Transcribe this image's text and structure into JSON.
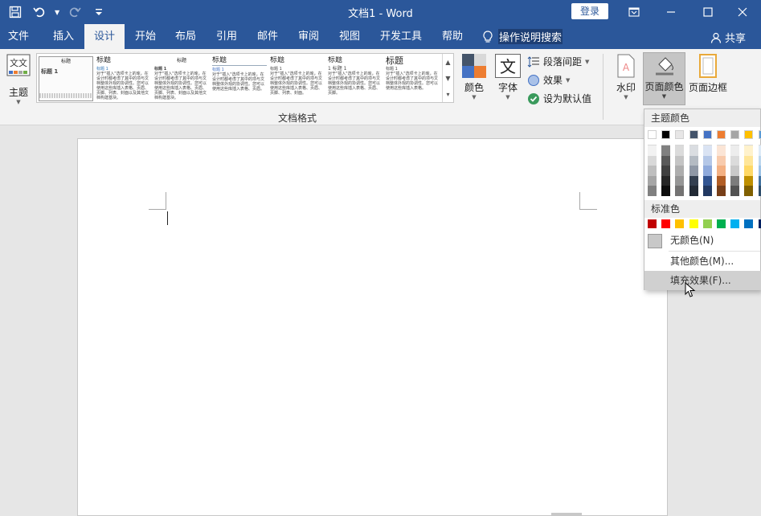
{
  "window": {
    "title": "文档1  -  Word",
    "login_label": "登录"
  },
  "tabs": [
    {
      "label": "文件"
    },
    {
      "label": "插入"
    },
    {
      "label": "设计"
    },
    {
      "label": "开始"
    },
    {
      "label": "布局"
    },
    {
      "label": "引用"
    },
    {
      "label": "邮件"
    },
    {
      "label": "审阅"
    },
    {
      "label": "视图"
    },
    {
      "label": "开发工具"
    },
    {
      "label": "帮助"
    }
  ],
  "tell_me": "操作说明搜索",
  "share": "共享",
  "ribbon": {
    "theme_label": "主题",
    "gallery_items": [
      {
        "title": "标题",
        "heading": "标题 1"
      },
      {
        "title": "标题",
        "heading": "标题 1"
      },
      {
        "title": "标题",
        "heading": "标题 1"
      },
      {
        "title": "标题",
        "heading": "标题 1"
      },
      {
        "title": "标题",
        "heading": "标题 1"
      },
      {
        "title": "标题",
        "heading": "1 标题 1"
      },
      {
        "title": "标题",
        "heading": "标题 1"
      }
    ],
    "group_label": "文档格式",
    "colors_label": "颜色",
    "fonts_label": "字体",
    "paragraph_spacing_label": "段落间距",
    "effects_label": "效果",
    "set_default_label": "设为默认值",
    "watermark_label": "水印",
    "page_color_label": "页面颜色",
    "page_borders_label": "页面边框"
  },
  "dropdown": {
    "theme_colors_header": "主题颜色",
    "standard_colors_header": "标准色",
    "no_color_label": "无颜色(N)",
    "more_colors_label": "其他颜色(M)...",
    "fill_effects_label": "填充效果(F)...",
    "theme_colors": [
      "#ffffff",
      "#000000",
      "#e7e6e6",
      "#44546a",
      "#4472c4",
      "#ed7d31",
      "#a5a5a5",
      "#ffc000",
      "#5b9bd5"
    ],
    "standard_colors": [
      "#c00000",
      "#ff0000",
      "#ffc000",
      "#ffff00",
      "#92d050",
      "#00b050",
      "#00b0f0",
      "#0070c0",
      "#002060"
    ]
  },
  "colors": {
    "title_bar": "#2b579a",
    "ribbon_bg": "#f3f3f3"
  }
}
